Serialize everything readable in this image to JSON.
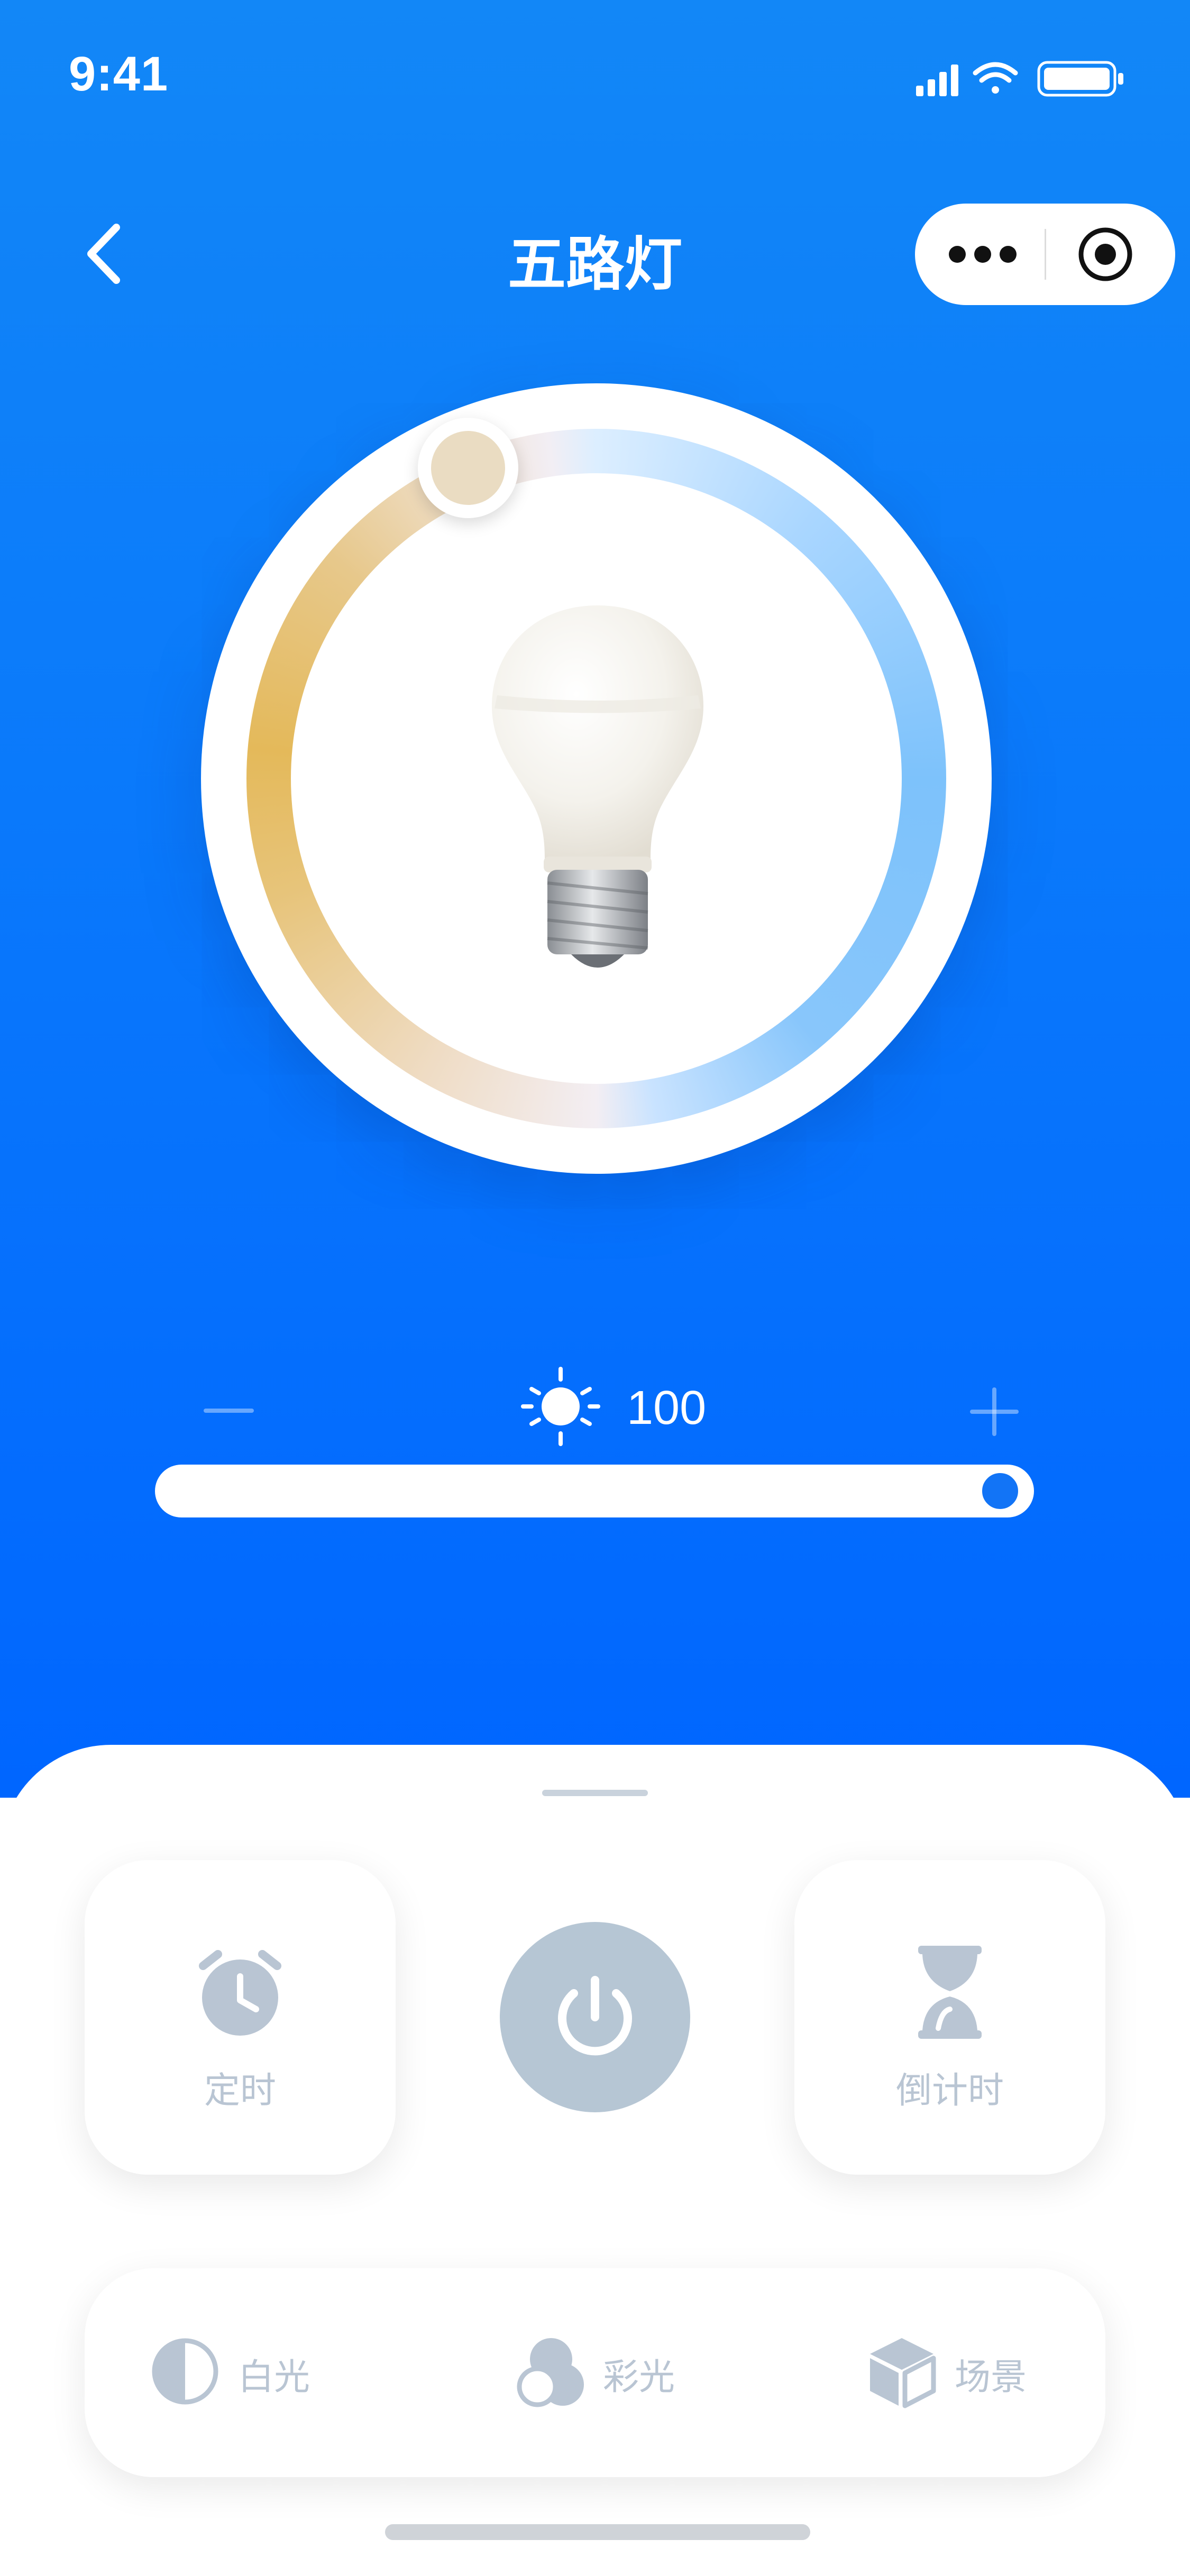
{
  "status_bar": {
    "time": "9:41"
  },
  "nav": {
    "title": "五路灯"
  },
  "brightness": {
    "value": "100",
    "level": 1.0
  },
  "color_temperature_knob": {
    "position_fraction": 0.92
  },
  "controls": {
    "timer_label": "定时",
    "countdown_label": "倒计时",
    "power_state": "off"
  },
  "modes": [
    {
      "label": "白光",
      "icon": "half-circle-icon"
    },
    {
      "label": "彩光",
      "icon": "color-circles-icon"
    },
    {
      "label": "场景",
      "icon": "cube-icon"
    }
  ],
  "colors": {
    "primary_blue": "#0a79fb",
    "inactive_gray": "#b9c5d3",
    "warm": "#e4b95a",
    "cool": "#7dc2fb"
  }
}
